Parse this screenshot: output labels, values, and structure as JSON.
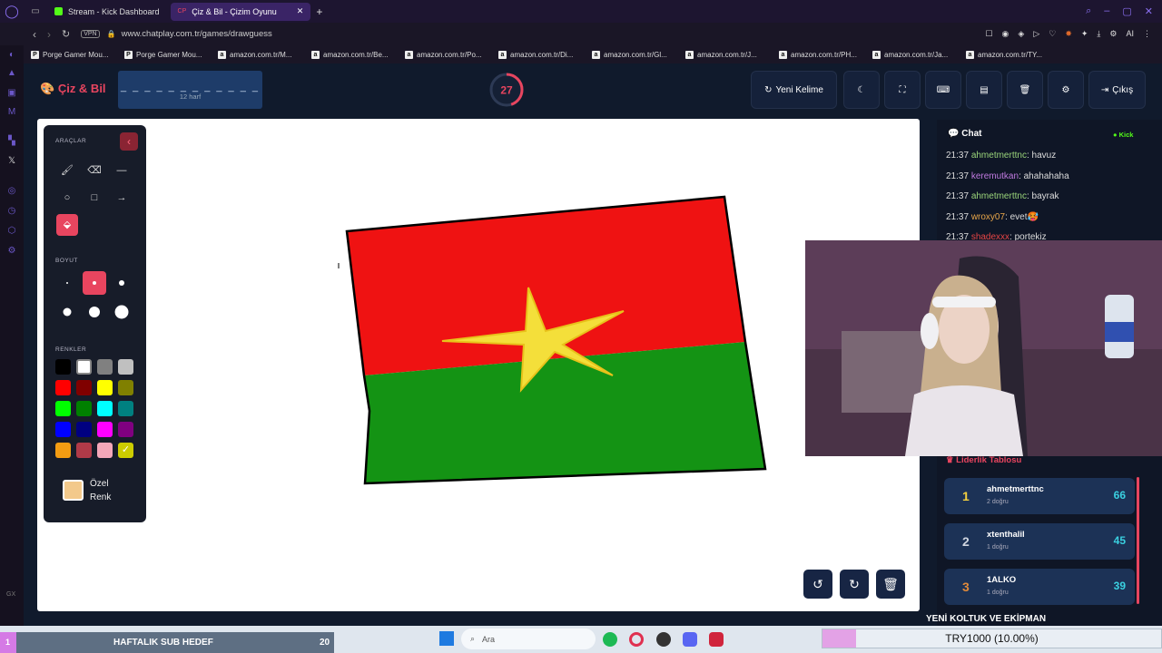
{
  "browser": {
    "tabs": [
      {
        "label": "Stream - Kick Dashboard",
        "active": false
      },
      {
        "label": "Çiz & Bil - Çizim Oyunu",
        "active": true
      }
    ],
    "vpn_badge": "VPN",
    "url": "www.chatplay.com.tr/games/drawguess",
    "ai_label": "AI",
    "bookmarks": [
      "Porge Gamer Mou...",
      "Porge Gamer Mou...",
      "amazon.com.tr/M...",
      "amazon.com.tr/Be...",
      "amazon.com.tr/Po...",
      "amazon.com.tr/Di...",
      "amazon.com.tr/Gl...",
      "amazon.com.tr/J...",
      "amazon.com.tr/PH...",
      "amazon.com.tr/Ja...",
      "amazon.com.tr/TY..."
    ],
    "side_label": "GX"
  },
  "game": {
    "logo": "Çiz & Bil",
    "word_mask": "_ _ _ _ _ _ _ _ _ _ _ _",
    "word_hint": "12 harf",
    "timer": {
      "value": "27",
      "fraction": 0.45
    },
    "buttons": {
      "new_word": "Yeni Kelime",
      "exit": "Çıkış"
    }
  },
  "tools": {
    "title": "ARAÇLAR",
    "size_title": "BOYUT",
    "colors_title": "RENKLER",
    "custom_color": "Özel Renk",
    "palette": [
      "#000000",
      "#ffffff",
      "#808080",
      "#c0c0c0",
      "#ff0000",
      "#800000",
      "#ffff00",
      "#808000",
      "#00ff00",
      "#008000",
      "#00ffff",
      "#008080",
      "#0000ff",
      "#000080",
      "#ff00ff",
      "#800080",
      "#f39c12",
      "#b03a48",
      "#f4a7b9",
      "#cccc00"
    ],
    "custom_swatch": "#f3c98b",
    "accent": "#e8455f"
  },
  "chat": {
    "title": "Chat",
    "platform": "Kick",
    "messages": [
      {
        "time": "21:37",
        "user": "ahmetmerttnc",
        "text": ": havuz",
        "color": "#9ad47a"
      },
      {
        "time": "21:37",
        "user": "keremutkan",
        "text": ": ahahahaha",
        "color": "#c07ae0"
      },
      {
        "time": "21:37",
        "user": "ahmetmerttnc",
        "text": ": bayrak",
        "color": "#9ad47a"
      },
      {
        "time": "21:37",
        "user": "wroxy07",
        "text": ": evet🥵",
        "color": "#e8a64a"
      },
      {
        "time": "21:37",
        "user": "shadexxx",
        "text": ": portekiz",
        "color": "#e84545"
      }
    ]
  },
  "leaderboard": {
    "title": "Liderlik Tablosu",
    "entries": [
      {
        "rank": "1",
        "name": "ahmetmerttnc",
        "sub": "2 doğru",
        "points": "66",
        "rank_color": "#f4d03f"
      },
      {
        "rank": "2",
        "name": "xtenthalil",
        "sub": "1 doğru",
        "points": "45",
        "rank_color": "#d0d6e0"
      },
      {
        "rank": "3",
        "name": "1ALKO",
        "sub": "1 doğru",
        "points": "39",
        "rank_color": "#e08a3a"
      }
    ]
  },
  "overlay": {
    "sub_goal": "HAFTALIK SUB HEDEF",
    "sub_goal_count": "20",
    "sub_goal_index": "1",
    "banner": "YENİ KOLTUK VE EKİPMAN",
    "donation": "TRY1000 (10.00%)",
    "donation_fraction": 0.1
  },
  "taskbar": {
    "search_placeholder": "Ara"
  }
}
